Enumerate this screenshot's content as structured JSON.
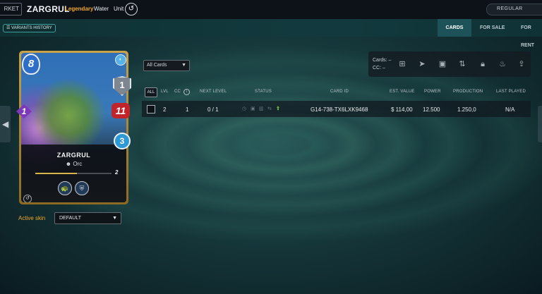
{
  "header": {
    "market_label": "RKET",
    "card_name": "ZARGRUL",
    "rarity": "Legendary",
    "element": "Water",
    "type": "Unit",
    "edition_icon": "untamed-edition-icon",
    "format_label": "REGULAR"
  },
  "subbar": {
    "variants_label": "☰ VARIANTS HISTORY",
    "tabs": [
      {
        "label": "CARDS",
        "active": true
      },
      {
        "label": "FOR SALE",
        "active": false
      },
      {
        "label": "FOR RENT",
        "active": false
      }
    ]
  },
  "card": {
    "mana": "8",
    "armor": "1",
    "attack": "1",
    "health": "11",
    "speed": "3",
    "name": "ZARGRUL",
    "race": "Orc",
    "level": "2",
    "level_progress": 0.55,
    "abilities": [
      "ability-1-icon",
      "ability-2-icon"
    ],
    "colors": {
      "frame": "#c9a24a",
      "mana": "#2d6fc8",
      "health": "#c2242b",
      "attack": "#7c38b9",
      "speed": "#2f99d6"
    }
  },
  "skin": {
    "label": "Active skin",
    "value": "DEFAULT"
  },
  "filter": {
    "value": "All Cards"
  },
  "actions": {
    "cards_line": "Cards: –",
    "cc_line": "CC: –",
    "icons": [
      "add-card-icon",
      "send-icon",
      "market-icon",
      "transfer-icon",
      "lock-icon",
      "burn-icon",
      "level-up-icon"
    ]
  },
  "table": {
    "all_label": "ALL",
    "headers": {
      "lvl": "LVL",
      "cc": "CC",
      "next_level": "NEXT LEVEL",
      "status": "STATUS",
      "card_id": "CARD ID",
      "est_value": "EST. VALUE",
      "power": "POWER",
      "production": "PRODUCTION",
      "last_played": "LAST PLAYED"
    },
    "rows": [
      {
        "lvl": "2",
        "cc": "1",
        "next_level": "0 / 1",
        "card_id": "G14-738-TX6LXK9468",
        "est_value": "$ 114,00",
        "power": "12.500",
        "production": "1.250,0",
        "last_played": "N/A"
      }
    ]
  }
}
